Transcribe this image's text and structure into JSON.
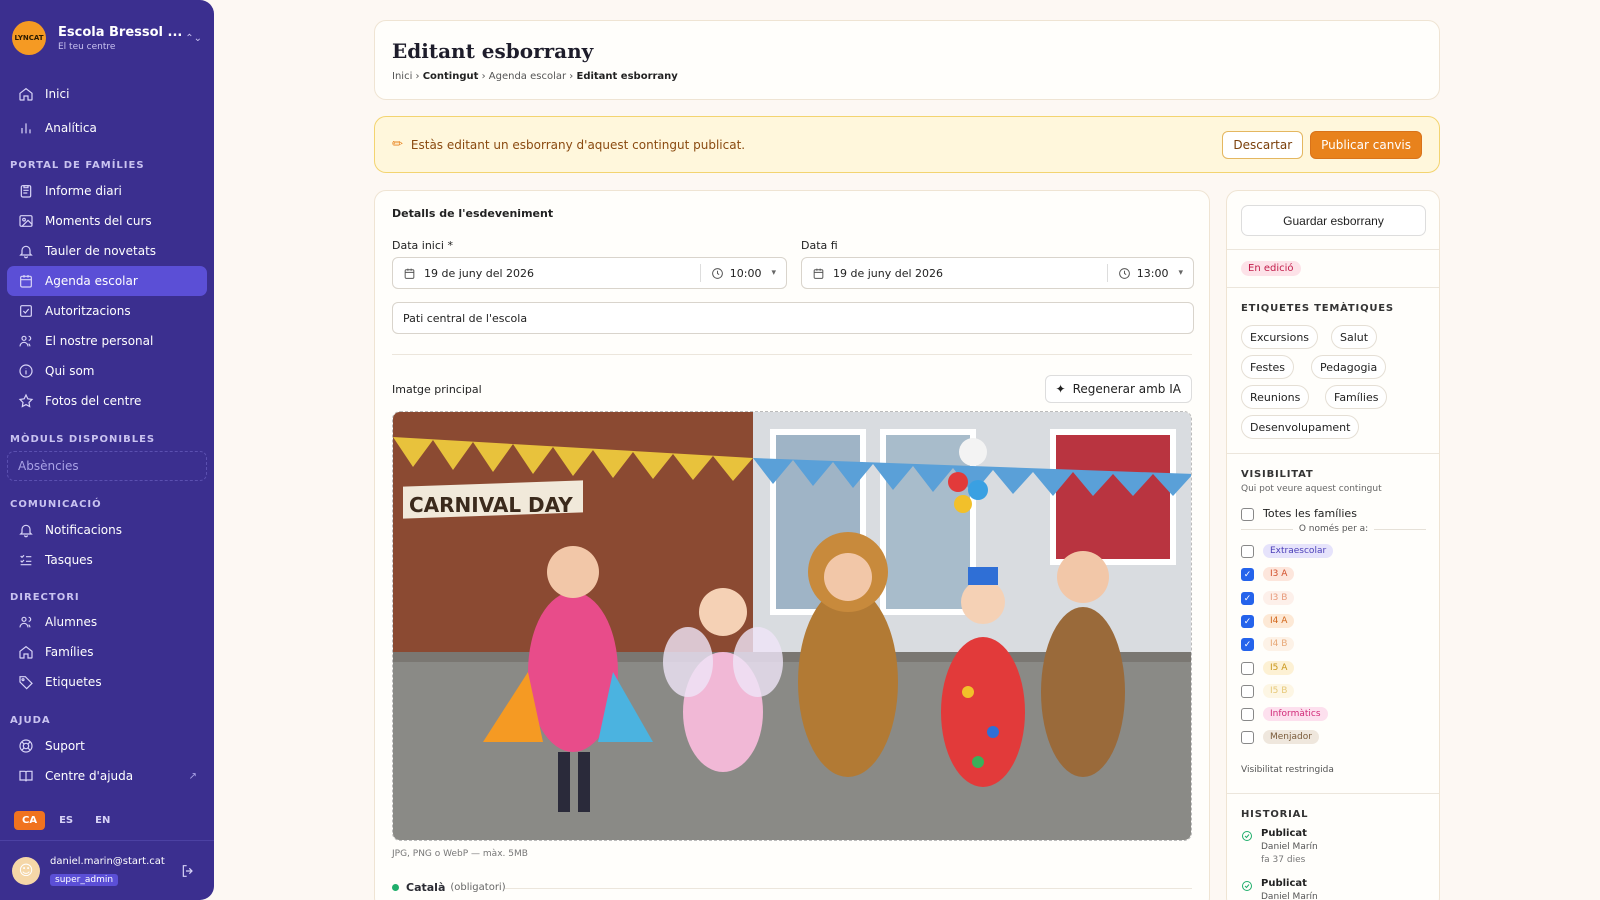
{
  "sidebar": {
    "brand_name": "Escola Bressol ...",
    "brand_sub": "El teu centre",
    "logo_text": "LYNCAT",
    "items_top": [
      {
        "label": "Inici",
        "icon": "home-icon"
      },
      {
        "label": "Analítica",
        "icon": "bar-chart-icon"
      }
    ],
    "sections": {
      "portal": "PORTAL DE FAMÍLIES",
      "modules": "MÒDULS DISPONIBLES",
      "comm": "COMUNICACIÓ",
      "directory": "DIRECTORI",
      "help": "AJUDA"
    },
    "portal_items": [
      {
        "label": "Informe diari"
      },
      {
        "label": "Moments del curs"
      },
      {
        "label": "Tauler de novetats"
      },
      {
        "label": "Agenda escolar"
      },
      {
        "label": "Autoritzacions"
      },
      {
        "label": "El nostre personal"
      },
      {
        "label": "Qui som"
      },
      {
        "label": "Fotos del centre"
      }
    ],
    "module_disabled": "Absències",
    "comm_items": [
      {
        "label": "Notificacions"
      },
      {
        "label": "Tasques"
      }
    ],
    "directory_items": [
      {
        "label": "Alumnes"
      },
      {
        "label": "Famílies"
      },
      {
        "label": "Etiquetes"
      }
    ],
    "help_items": [
      {
        "label": "Suport"
      },
      {
        "label": "Centre d'ajuda"
      }
    ],
    "languages": [
      "CA",
      "ES",
      "EN"
    ],
    "user_email": "daniel.marin@start.cat",
    "user_role": "super_admin",
    "accent": "#3b2f8f"
  },
  "header": {
    "title": "Editant esborrany",
    "crumbs": [
      "Inici",
      "Contingut",
      "Agenda escolar",
      "Editant esborrany"
    ]
  },
  "banner": {
    "text": "Estàs editant un esborrany d'aquest contingut publicat.",
    "discard": "Descartar",
    "publish": "Publicar canvis"
  },
  "form": {
    "section_title": "Detalls de l'esdeveniment",
    "start_label": "Data inici *",
    "start_date": "19 de juny del 2026",
    "start_time": "10:00",
    "end_label": "Data fi",
    "end_date": "19 de juny del 2026",
    "end_time": "13:00",
    "location": "Pati central de l'escola",
    "image_label": "Imatge principal",
    "regen": "Regenerar amb IA",
    "image_banner_text": "CARNIVAL DAY",
    "image_hint": "JPG, PNG o WebP — màx. 5MB",
    "lang_name": "Català",
    "lang_required": "(obligatori)"
  },
  "side": {
    "save": "Guardar esborrany",
    "status": "En edició",
    "tags_title": "ETIQUETES TEMÀTIQUES",
    "tags": [
      "Excursions",
      "Salut",
      "Festes",
      "Pedagogia",
      "Reunions",
      "Famílies",
      "Desenvolupament"
    ],
    "vis_title": "VISIBILITAT",
    "vis_sub": "Qui pot veure aquest contingut",
    "all_families": "Totes les famílies",
    "only_for": "O només per a:",
    "groups": [
      {
        "name": "Extraescolar",
        "checked": false,
        "fg": "#4b3fb8",
        "bg": "#e6e3fb"
      },
      {
        "name": "I3 A",
        "checked": true,
        "fg": "#d2502b",
        "bg": "#fde6dc"
      },
      {
        "name": "I3 B",
        "checked": true,
        "fg": "#e79a7a",
        "bg": "#fdf0ea"
      },
      {
        "name": "I4 A",
        "checked": true,
        "fg": "#d2671b",
        "bg": "#fde9d6"
      },
      {
        "name": "I4 B",
        "checked": true,
        "fg": "#e7a877",
        "bg": "#fdf2e7"
      },
      {
        "name": "I5 A",
        "checked": false,
        "fg": "#c9961a",
        "bg": "#fdf1d4"
      },
      {
        "name": "I5 B",
        "checked": false,
        "fg": "#e6c878",
        "bg": "#fdf6e4"
      },
      {
        "name": "Informàtics",
        "checked": false,
        "fg": "#d12a78",
        "bg": "#fde0ee"
      },
      {
        "name": "Menjador",
        "checked": false,
        "fg": "#7a5b3a",
        "bg": "#efe7dd"
      }
    ],
    "restricted": "Visibilitat restringida",
    "history_title": "HISTORIAL",
    "history": [
      {
        "status": "Publicat",
        "who": "Daniel Marín",
        "ago": "fa 37 dies"
      },
      {
        "status": "Publicat",
        "who": "Daniel Marín",
        "ago": ""
      }
    ]
  }
}
